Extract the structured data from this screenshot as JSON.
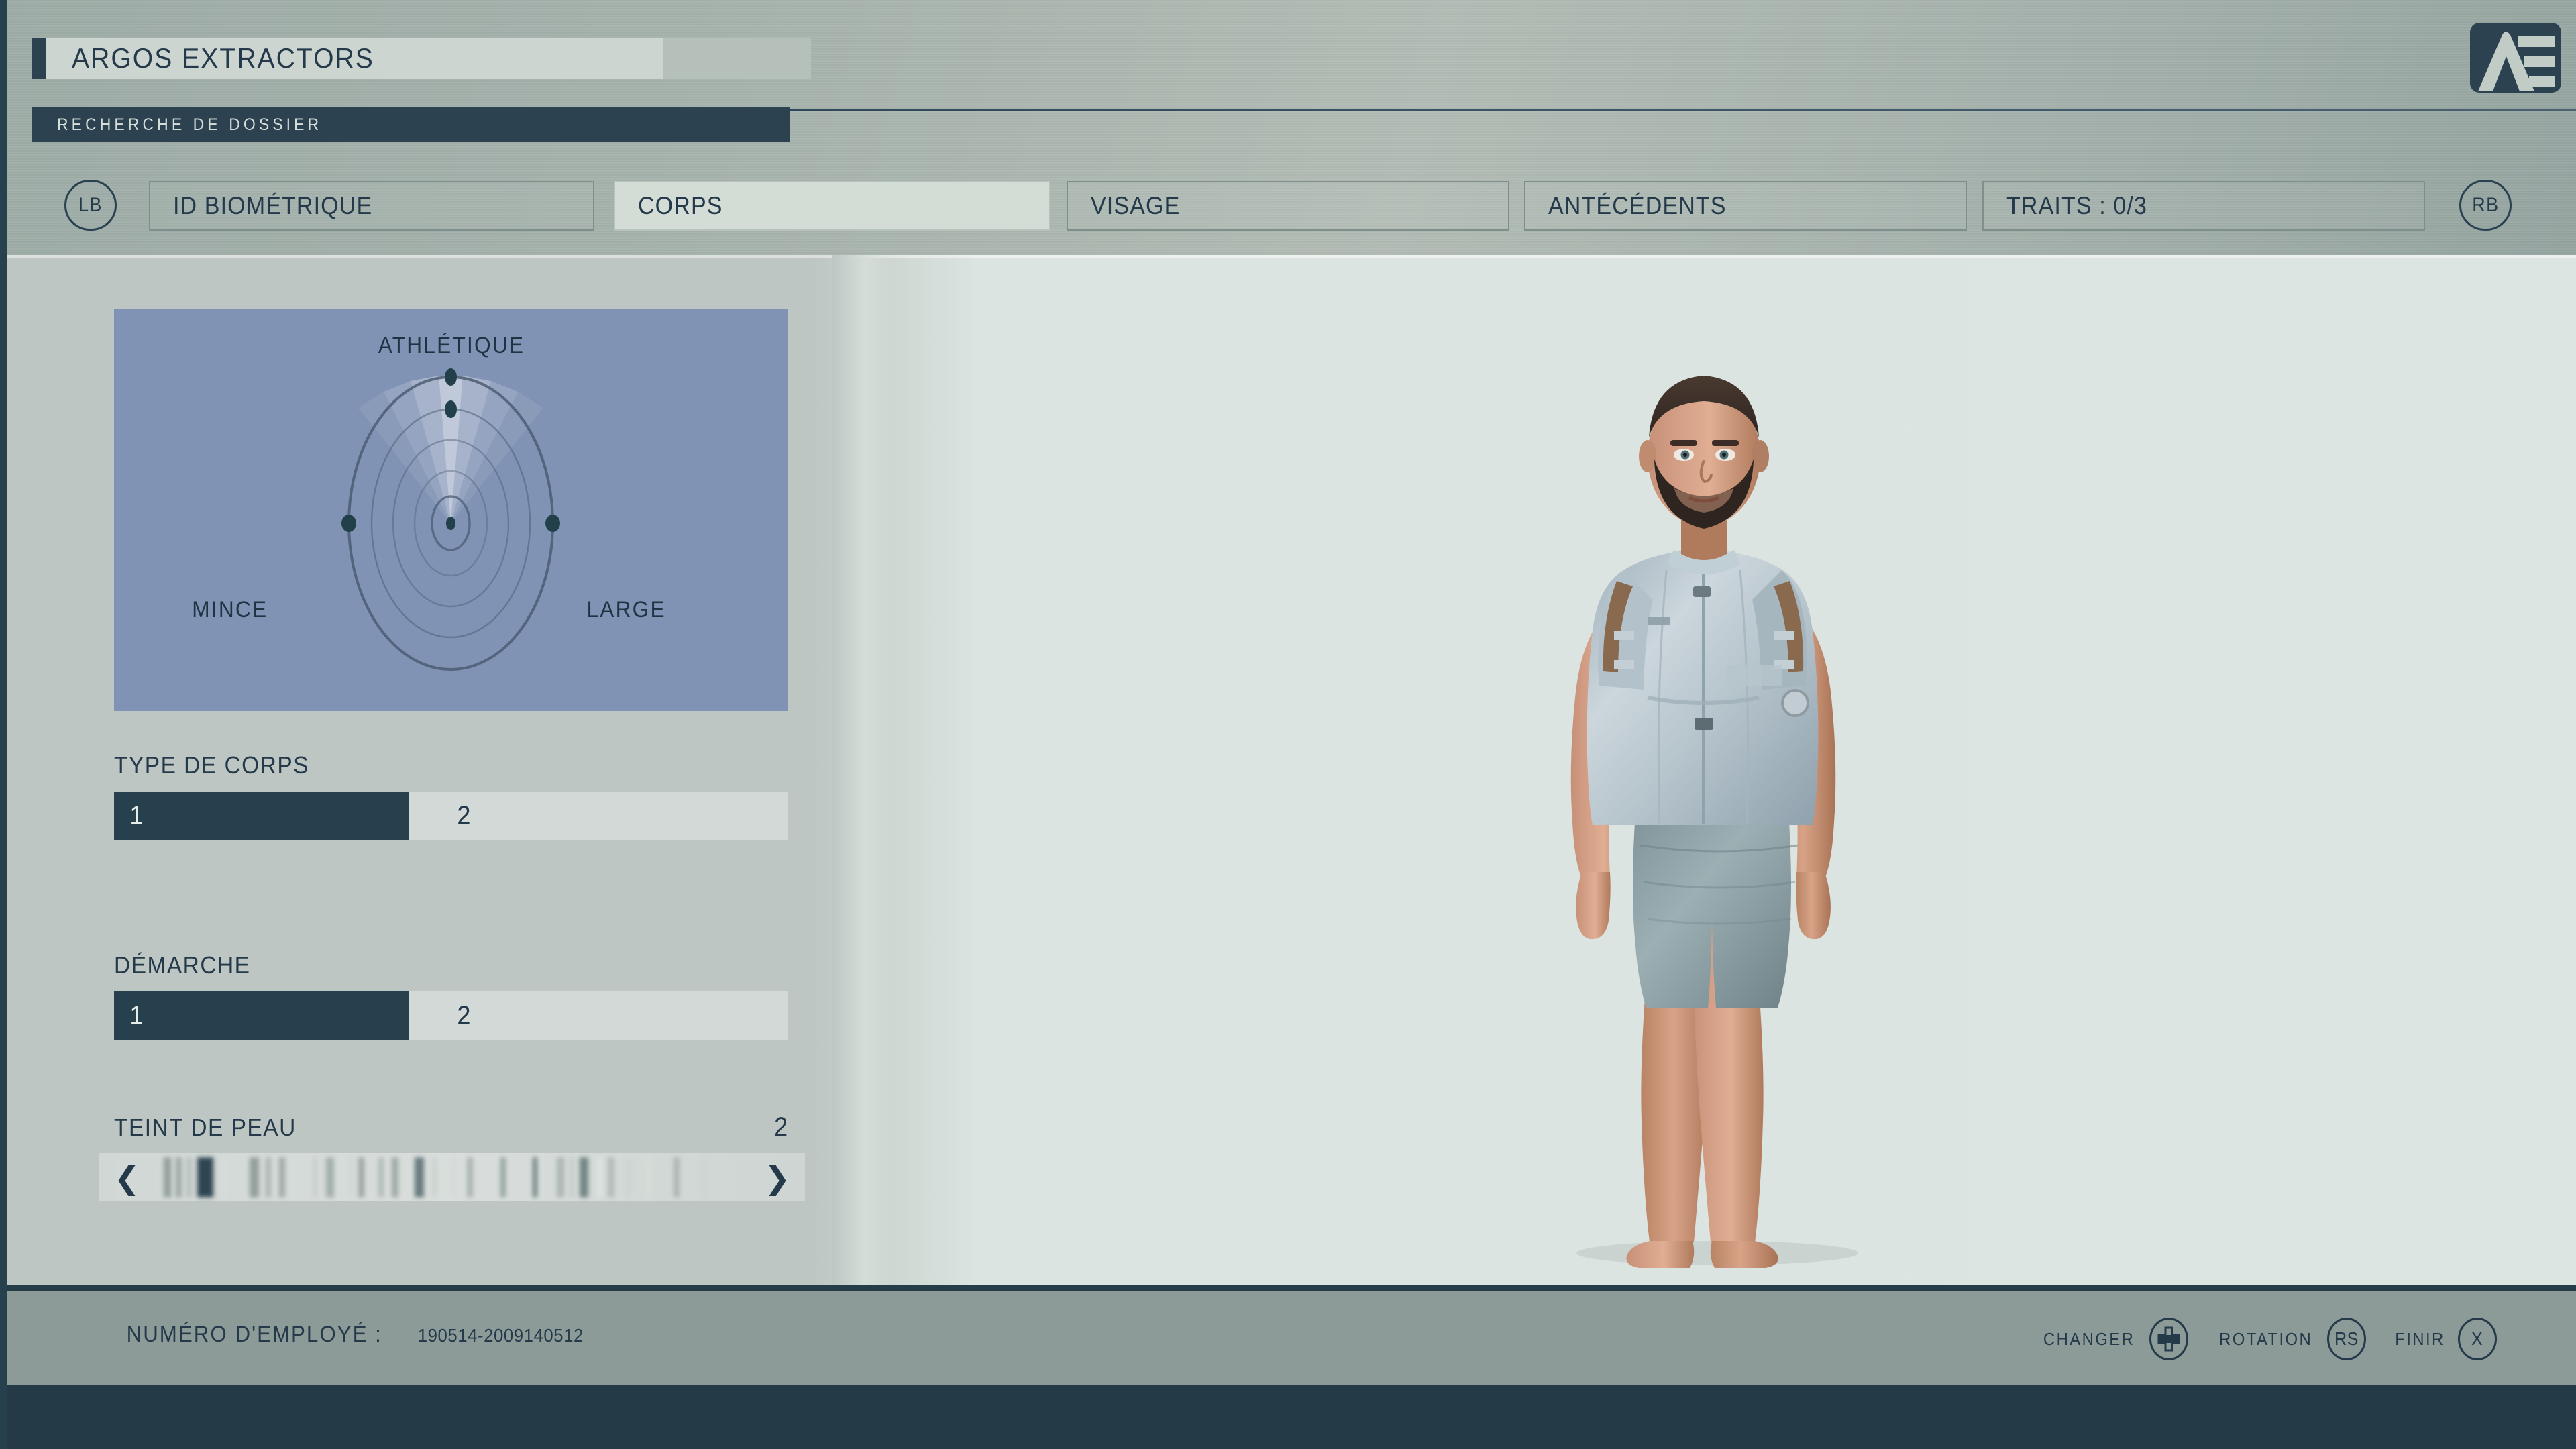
{
  "header": {
    "title": "ARGOS EXTRACTORS",
    "subtitle": "RECHERCHE DE DOSSIER",
    "logo_icon": "ae-logo-icon"
  },
  "tabbar": {
    "left_bumper": "LB",
    "right_bumper": "RB",
    "tabs": [
      {
        "label": "ID BIOMÉTRIQUE",
        "active": false
      },
      {
        "label": "CORPS",
        "active": true
      },
      {
        "label": "VISAGE",
        "active": false
      },
      {
        "label": "ANTÉCÉDENTS",
        "active": false
      },
      {
        "label": "TRAITS : 0/3",
        "active": false
      }
    ]
  },
  "sidebar": {
    "radar": {
      "top_label": "ATHLÉTIQUE",
      "left_label": "MINCE",
      "right_label": "LARGE",
      "background_color": "#8093b5",
      "cursor_ring": 2,
      "cursor_angle_deg": 90
    },
    "fields": [
      {
        "label": "TYPE DE CORPS",
        "type": "segmented",
        "options": [
          "1",
          "2"
        ],
        "selected": "1"
      },
      {
        "label": "DÉMARCHE",
        "type": "segmented",
        "options": [
          "1",
          "2"
        ],
        "selected": "1"
      },
      {
        "label": "TEINT DE PEAU",
        "type": "carousel",
        "value": "2",
        "prev_icon": "chevron-left-icon",
        "next_icon": "chevron-right-icon"
      }
    ]
  },
  "footer": {
    "employee_key": "NUMÉRO D'EMPLOYÉ :",
    "employee_number": "190514-2009140512",
    "prompts": [
      {
        "label": "CHANGER",
        "button": "",
        "icon": "dpad-icon"
      },
      {
        "label": "ROTATION",
        "button": "RS",
        "icon": "stick-button-icon"
      },
      {
        "label": "FINIR",
        "button": "X",
        "icon": "face-button-icon"
      }
    ]
  },
  "colors": {
    "accent_dark": "#2c4250",
    "panel_light": "#dde5e2",
    "sidebar": "#bdc6c2",
    "radar_bg": "#8093b5",
    "footer_bar": "#8c9b98",
    "text_dark": "#24394a"
  }
}
